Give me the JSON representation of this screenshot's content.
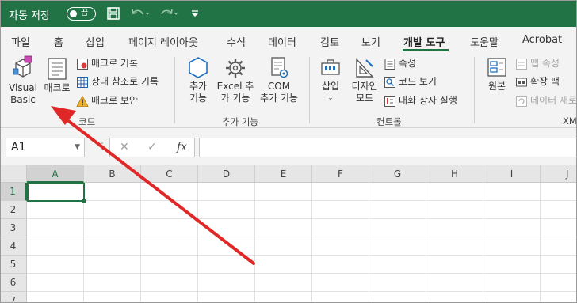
{
  "titlebar": {
    "autosave_label": "자동 저장",
    "autosave_state": "끔",
    "icons": [
      "save-icon",
      "undo-icon",
      "redo-icon",
      "customize-qat-icon"
    ]
  },
  "tabs": [
    "파일",
    "홈",
    "삽입",
    "페이지 레이아웃",
    "수식",
    "데이터",
    "검토",
    "보기",
    "개발 도구",
    "도움말",
    "Acrobat"
  ],
  "active_tab": "개발 도구",
  "ribbon": {
    "code": {
      "group_label": "코드",
      "visual_basic": "Visual\nBasic",
      "macros": "매크로",
      "record_macro": "매크로 기록",
      "relative_refs": "상대 참조로 기록",
      "macro_security": "매크로 보안"
    },
    "addins": {
      "group_label": "추가 기능",
      "addins": "추가\n기능",
      "excel_addins": "Excel 추\n가 기능",
      "com_addins": "COM\n추가 기능"
    },
    "controls": {
      "group_label": "컨트롤",
      "insert": "삽입",
      "design_mode": "디자인\n모드",
      "properties": "속성",
      "view_code": "코드 보기",
      "run_dialog": "대화 상자 실행"
    },
    "xml": {
      "group_label": "XM",
      "source": "원본",
      "map_properties": "맵 속성",
      "expansion_packs": "확장 팩",
      "refresh_data": "데이터 새로"
    }
  },
  "formula_bar": {
    "name_box": "A1",
    "fx_label": "fx",
    "cancel_icon": "✕",
    "enter_icon": "✓",
    "formula_value": ""
  },
  "grid": {
    "columns": [
      "A",
      "B",
      "C",
      "D",
      "E",
      "F",
      "G",
      "H",
      "I",
      "J"
    ],
    "rows": [
      "1",
      "2",
      "3",
      "4",
      "5",
      "6",
      "7"
    ],
    "selected_cell": "A1"
  },
  "colors": {
    "excel_green": "#217346",
    "ribbon_bg": "#f3f3f3",
    "annotation_arrow": "#e02828"
  }
}
